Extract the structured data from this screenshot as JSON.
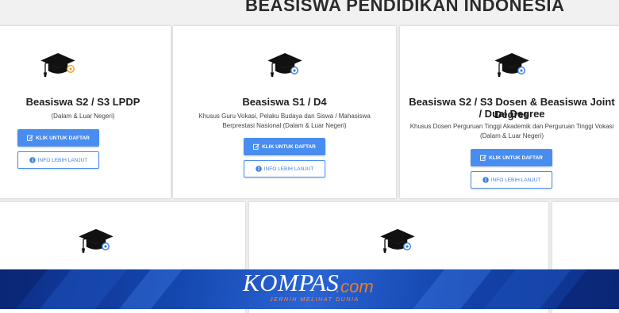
{
  "page": {
    "title": "BEASISWA PENDIDIKAN INDONESIA"
  },
  "cards": [
    {
      "title": "Beasiswa S2 / S3 LPDP",
      "desc": "(Dalam & Luar Negeri)",
      "register_label": "KLIK UNTUK DAFTAR",
      "info_label": "INFO LEBIH LANJUT"
    },
    {
      "title": "Beasiswa S1 / D4",
      "desc": "Khusus Guru Vokasi, Pelaku Budaya dan Siswa / Mahasiswa Berprestasi Nasional (Dalam & Luar Negeri)",
      "register_label": "KLIK UNTUK DAFTAR",
      "info_label": "INFO LEBIH LANJUT"
    },
    {
      "title_line1": "Beasiswa S2 / S3 Dosen & Beasiswa Joint Degree",
      "title_line2": "/ Dual Degree",
      "desc": "Khusus Dosen Perguruan Tinggi Akademik dan Perguruan Tinggi Vokasi (Dalam & Luar Negeri)",
      "register_label": "KLIK UNTUK DAFTAR",
      "info_label": "INFO LEBIH LANJUT"
    }
  ],
  "icons": {
    "card_icon": "graduation-cap-icon",
    "register_icon": "edit-icon",
    "info_icon": "info-circle-icon"
  },
  "colors": {
    "primary": "#4a8df0",
    "banner_blue": "#1446ad",
    "banner_accent": "#f47a20"
  },
  "banner": {
    "brand": "KOMPAS",
    "tld": ".com",
    "tagline": "JERNIH MELIHAT DUNIA"
  }
}
